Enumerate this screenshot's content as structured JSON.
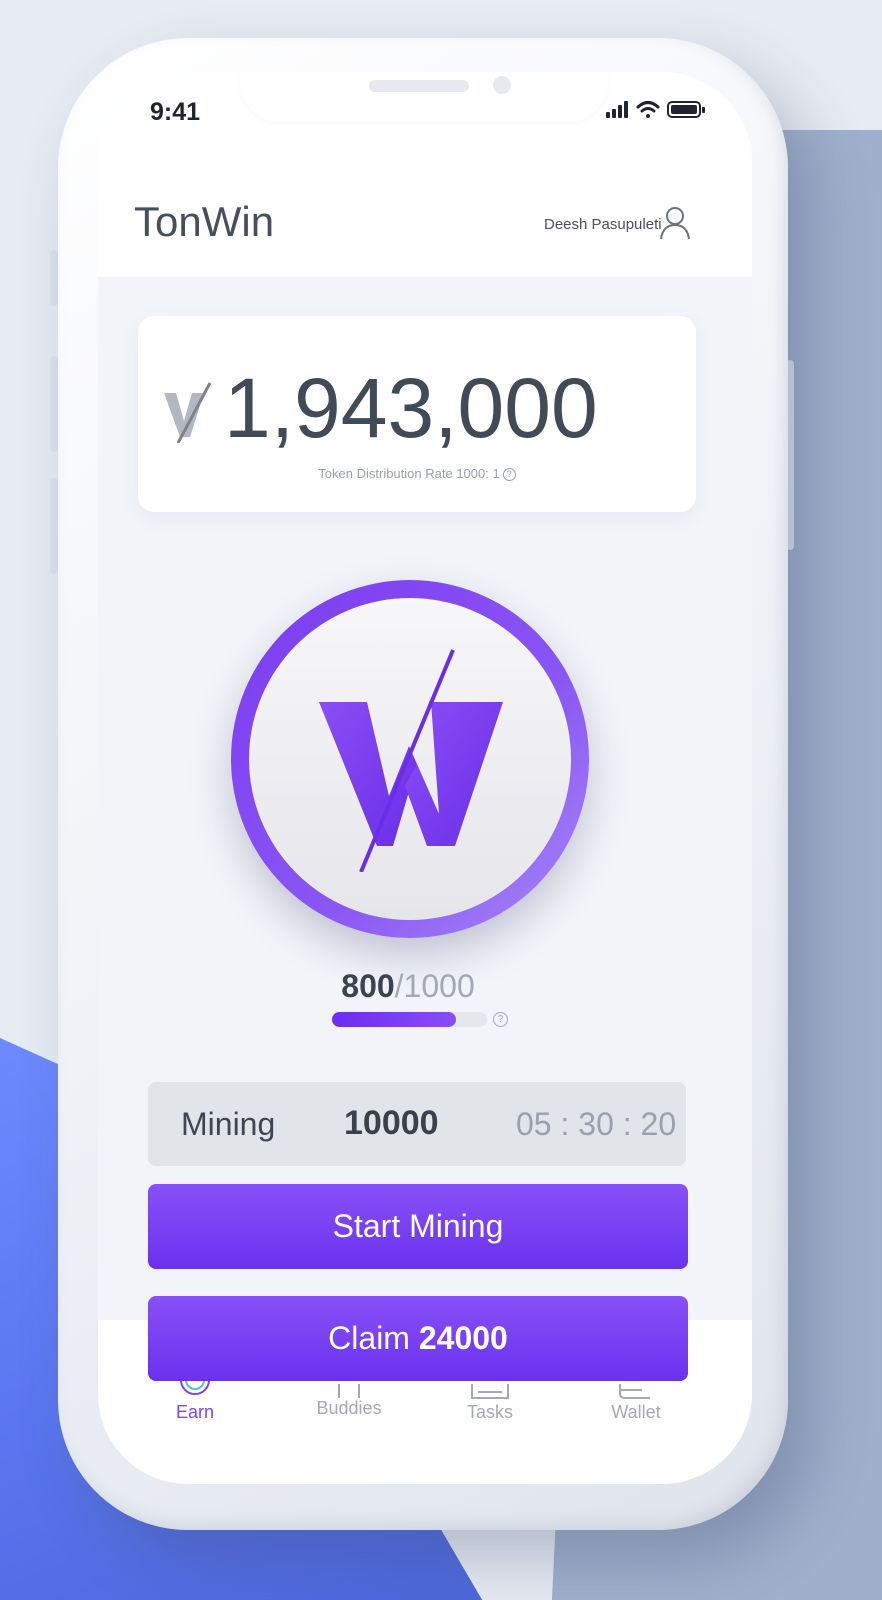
{
  "status_bar": {
    "time": "9:41"
  },
  "header": {
    "app_title": "TonWin",
    "user_name": "Deesh Pasupuleti"
  },
  "balance": {
    "amount": "1,943,000",
    "rate_label": "Token Distribution Rate",
    "rate_value": "1000: 1",
    "help_glyph": "?"
  },
  "energy": {
    "current": "800",
    "separator": "/",
    "max": "1000",
    "fill_fraction": 0.8,
    "help_glyph": "?"
  },
  "mining": {
    "label": "Mining",
    "amount": "10000",
    "timer": "05 : 30 : 20"
  },
  "buttons": {
    "start_mining": "Start Mining",
    "claim_label": "Claim",
    "claim_amount": "24000"
  },
  "nav": {
    "items": [
      {
        "label": "Earn",
        "icon": "earn-icon",
        "active": true
      },
      {
        "label": "Buddies",
        "icon": "buddies-icon",
        "active": false
      },
      {
        "label": "Tasks",
        "icon": "tasks-icon",
        "active": false
      },
      {
        "label": "Wallet",
        "icon": "wallet-icon",
        "active": false
      }
    ]
  },
  "colors": {
    "accent": "#7b3bf0",
    "accent_dark": "#6a32ee",
    "text_dark": "#414a57",
    "text_muted": "#9aa0aa"
  }
}
